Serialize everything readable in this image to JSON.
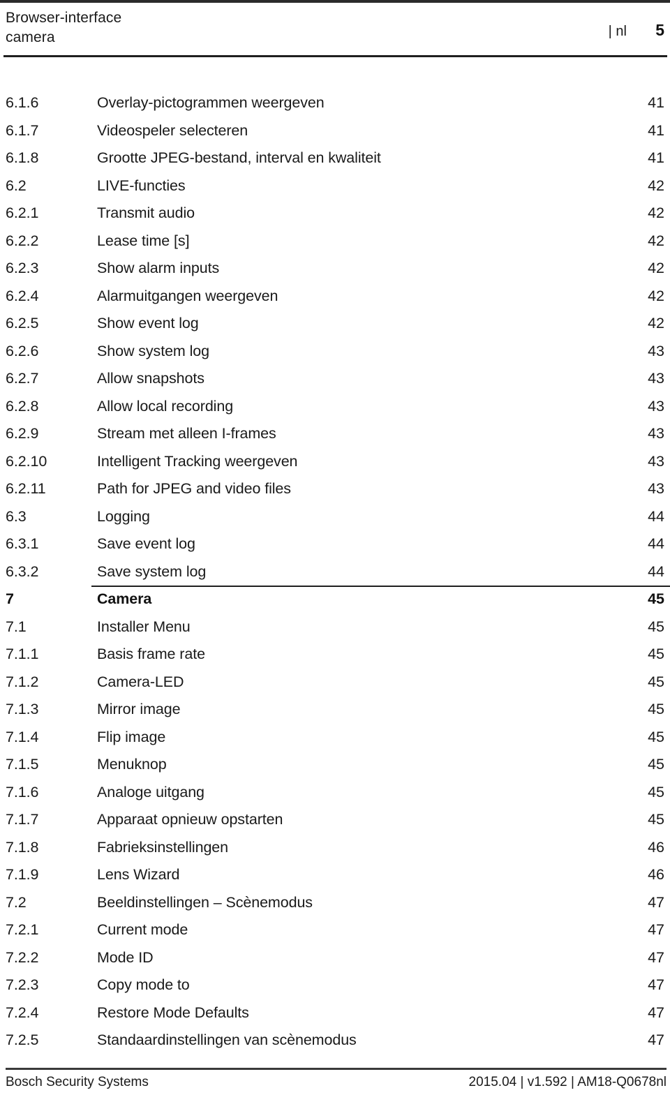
{
  "header": {
    "title": "Browser-interface\ncamera",
    "language": "| nl",
    "page_number": "5"
  },
  "toc": {
    "entries": [
      {
        "number": "6.1.6",
        "title": "Overlay-pictogrammen weergeven",
        "page": "41",
        "level": 3,
        "rule_above": false
      },
      {
        "number": "6.1.7",
        "title": "Videospeler selecteren",
        "page": "41",
        "level": 3,
        "rule_above": false
      },
      {
        "number": "6.1.8",
        "title": "Grootte JPEG-bestand, interval en kwaliteit",
        "page": "41",
        "level": 3,
        "rule_above": false
      },
      {
        "number": "6.2",
        "title": "LIVE-functies",
        "page": "42",
        "level": 2,
        "rule_above": false
      },
      {
        "number": "6.2.1",
        "title": "Transmit audio",
        "page": "42",
        "level": 3,
        "rule_above": false
      },
      {
        "number": "6.2.2",
        "title": "Lease time [s]",
        "page": "42",
        "level": 3,
        "rule_above": false
      },
      {
        "number": "6.2.3",
        "title": "Show alarm inputs",
        "page": "42",
        "level": 3,
        "rule_above": false
      },
      {
        "number": "6.2.4",
        "title": "Alarmuitgangen weergeven",
        "page": "42",
        "level": 3,
        "rule_above": false
      },
      {
        "number": "6.2.5",
        "title": "Show event log",
        "page": "42",
        "level": 3,
        "rule_above": false
      },
      {
        "number": "6.2.6",
        "title": "Show system log",
        "page": "43",
        "level": 3,
        "rule_above": false
      },
      {
        "number": "6.2.7",
        "title": "Allow snapshots",
        "page": "43",
        "level": 3,
        "rule_above": false
      },
      {
        "number": "6.2.8",
        "title": "Allow local recording",
        "page": "43",
        "level": 3,
        "rule_above": false
      },
      {
        "number": "6.2.9",
        "title": "Stream met alleen I-frames",
        "page": "43",
        "level": 3,
        "rule_above": false
      },
      {
        "number": "6.2.10",
        "title": "Intelligent Tracking weergeven",
        "page": "43",
        "level": 3,
        "rule_above": false
      },
      {
        "number": "6.2.11",
        "title": "Path for JPEG and video files",
        "page": "43",
        "level": 3,
        "rule_above": false
      },
      {
        "number": "6.3",
        "title": "Logging",
        "page": "44",
        "level": 2,
        "rule_above": false
      },
      {
        "number": "6.3.1",
        "title": "Save event log",
        "page": "44",
        "level": 3,
        "rule_above": false
      },
      {
        "number": "6.3.2",
        "title": "Save system log",
        "page": "44",
        "level": 3,
        "rule_above": false
      },
      {
        "number": "7",
        "title": "Camera",
        "page": "45",
        "level": 1,
        "rule_above": true
      },
      {
        "number": "7.1",
        "title": "Installer Menu",
        "page": "45",
        "level": 2,
        "rule_above": false
      },
      {
        "number": "7.1.1",
        "title": "Basis frame rate",
        "page": "45",
        "level": 3,
        "rule_above": false
      },
      {
        "number": "7.1.2",
        "title": "Camera-LED",
        "page": "45",
        "level": 3,
        "rule_above": false
      },
      {
        "number": "7.1.3",
        "title": "Mirror image",
        "page": "45",
        "level": 3,
        "rule_above": false
      },
      {
        "number": "7.1.4",
        "title": "Flip image",
        "page": "45",
        "level": 3,
        "rule_above": false
      },
      {
        "number": "7.1.5",
        "title": "Menuknop",
        "page": "45",
        "level": 3,
        "rule_above": false
      },
      {
        "number": "7.1.6",
        "title": "Analoge uitgang",
        "page": "45",
        "level": 3,
        "rule_above": false
      },
      {
        "number": "7.1.7",
        "title": "Apparaat opnieuw opstarten",
        "page": "45",
        "level": 3,
        "rule_above": false
      },
      {
        "number": "7.1.8",
        "title": "Fabrieksinstellingen",
        "page": "46",
        "level": 3,
        "rule_above": false
      },
      {
        "number": "7.1.9",
        "title": "Lens Wizard",
        "page": "46",
        "level": 3,
        "rule_above": false
      },
      {
        "number": "7.2",
        "title": "Beeldinstellingen – Scènemodus",
        "page": "47",
        "level": 2,
        "rule_above": false
      },
      {
        "number": "7.2.1",
        "title": "Current mode",
        "page": "47",
        "level": 3,
        "rule_above": false
      },
      {
        "number": "7.2.2",
        "title": "Mode ID",
        "page": "47",
        "level": 3,
        "rule_above": false
      },
      {
        "number": "7.2.3",
        "title": "Copy mode to",
        "page": "47",
        "level": 3,
        "rule_above": false
      },
      {
        "number": "7.2.4",
        "title": "Restore Mode Defaults",
        "page": "47",
        "level": 3,
        "rule_above": false
      },
      {
        "number": "7.2.5",
        "title": "Standaardinstellingen van scènemodus",
        "page": "47",
        "level": 3,
        "rule_above": false
      }
    ]
  },
  "footer": {
    "left": "Bosch Security Systems",
    "right": "2015.04 | v1.592 | AM18-Q0678nl"
  }
}
